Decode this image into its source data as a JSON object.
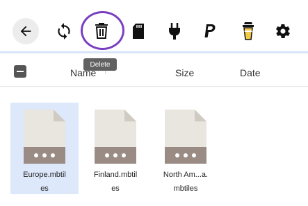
{
  "toolbar": {
    "icons": [
      "back-icon",
      "refresh-icon",
      "trash-icon",
      "sd-card-icon",
      "plug-icon",
      "paypal-icon",
      "coffee-cup-icon",
      "gear-icon"
    ],
    "highlight_color": "#7a3fc1"
  },
  "tooltip": {
    "text": "Delete"
  },
  "table_header": {
    "name_label": "Name",
    "sort_indicator": "↑",
    "size_label": "Size",
    "date_label": "Date"
  },
  "files": [
    {
      "name_line1": "Europe.mbtil",
      "name_line2": "es",
      "selected": true
    },
    {
      "name_line1": "Finland.mbtil",
      "name_line2": "es",
      "selected": false
    },
    {
      "name_line1": "North Am...a.",
      "name_line2": "mbtiles",
      "selected": false
    }
  ],
  "colors": {
    "selection": "#dde8fb",
    "accent_divider": "#d6e6f7"
  }
}
